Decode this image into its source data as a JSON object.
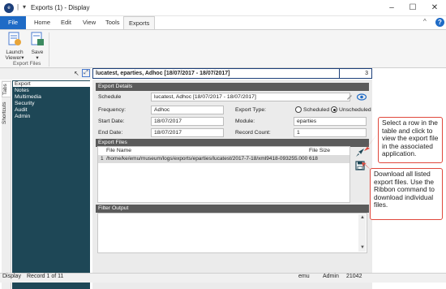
{
  "window": {
    "title": "Exports (1) - Display",
    "separator": "|",
    "menu_glyph": "▾",
    "app_icon": "emu-logo",
    "minimize": "–",
    "maximize": "☐",
    "close": "✕"
  },
  "ribbon_tabs": [
    "File",
    "Home",
    "Edit",
    "View",
    "Tools",
    "Exports"
  ],
  "active_tab": "Exports",
  "ribbon": {
    "launch_label": "Launch Viewer",
    "launch_caret": "▾",
    "save_label": "Save",
    "save_caret": "▾",
    "group_label": "Export Files",
    "collapse_glyph": "^",
    "help_glyph": "?"
  },
  "left": {
    "vtabs": [
      "Tabs",
      "Shortcuts"
    ],
    "nav_items": [
      "Export",
      "Notes",
      "Multimedia",
      "Security",
      "Audit",
      "Admin"
    ],
    "selected": "Export"
  },
  "record": {
    "header": "lucatest, eparties, Adhoc [18/07/2017 - 18/07/2017]",
    "count": "3"
  },
  "export_details": {
    "section_title": "Export Details",
    "schedule_label": "Schedule",
    "schedule_value": "lucatest, Adhoc [18/07/2017 - 18/07/2017]",
    "frequency_label": "Frequency:",
    "frequency_value": "Adhoc",
    "export_type_label": "Export Type:",
    "scheduled_label": "Scheduled",
    "unscheduled_label": "Unscheduled",
    "selected_type": "Unscheduled",
    "start_label": "Start Date:",
    "start_value": "18/07/2017",
    "module_label": "Module:",
    "module_value": "eparties",
    "end_label": "End Date:",
    "end_value": "18/07/2017",
    "record_count_label": "Record Count:",
    "record_count_value": "1"
  },
  "export_files": {
    "section_title": "Export Files",
    "columns": [
      "File Name",
      "File Size"
    ],
    "rows": [
      {
        "num": "1",
        "name": "/home/ke/emu/museum/logs/exports/eparties/lucatest/2017-7-18/xml9418-093255.000000",
        "size": "618"
      }
    ]
  },
  "filter_output": {
    "section_title": "Filter Output"
  },
  "callouts": {
    "launch": "Select a row in the table and click to view the export file in the associated application.",
    "save": "Download all listed export files. Use the Ribbon command to download individual files."
  },
  "status": {
    "mode": "Display",
    "record": "Record 1 of 11",
    "user": "emu",
    "group": "Admin",
    "number": "21042"
  },
  "colors": {
    "file_tab": "#1f6bc6",
    "nav_panel": "#1e4756",
    "section_header": "#5b5b5b",
    "callout_border": "#e0483c",
    "record_border": "#1c3f7a"
  }
}
